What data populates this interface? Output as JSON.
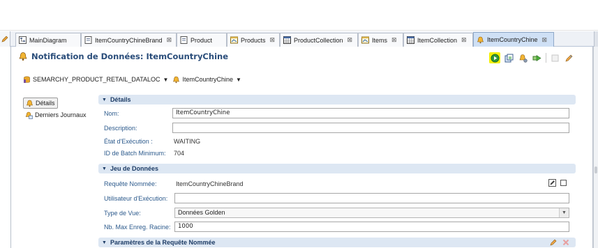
{
  "tabs": [
    {
      "label": "MainDiagram",
      "icon": "diagram-icon",
      "closable": false,
      "active": false
    },
    {
      "label": "ItemCountryChineBrand",
      "icon": "entity-icon",
      "closable": true,
      "active": false
    },
    {
      "label": "Product",
      "icon": "entity-icon",
      "closable": false,
      "active": false
    },
    {
      "label": "Products",
      "icon": "collection-icon",
      "closable": true,
      "active": false
    },
    {
      "label": "ProductCollection",
      "icon": "table-icon",
      "closable": true,
      "active": false
    },
    {
      "label": "Items",
      "icon": "collection-icon",
      "closable": true,
      "active": false
    },
    {
      "label": "ItemCollection",
      "icon": "table-icon",
      "closable": true,
      "active": false
    },
    {
      "label": "ItemCountryChine",
      "icon": "bell-icon",
      "closable": true,
      "active": true
    }
  ],
  "editor": {
    "title": "Notification de Données: ItemCountryChine",
    "breadcrumb": {
      "dataloc": "SEMARCHY_PRODUCT_RETAIL_DATALOC",
      "item": "ItemCountryChine"
    }
  },
  "toolbar": {
    "buttons": [
      "run-icon",
      "export-icon",
      "bell-gear-icon",
      "forward-icon",
      "disabled-icon",
      "edit-icon"
    ],
    "highlight": "#f3f000"
  },
  "nav": {
    "items": [
      {
        "label": "Détails",
        "selected": true
      },
      {
        "label": "Derniers Journaux",
        "selected": false
      }
    ]
  },
  "details": {
    "title": "Détails",
    "name_label": "Nom:",
    "name_value": "ItemCountryChine",
    "description_label": "Description:",
    "description_value": "",
    "state_label": "État d'Exécution :",
    "state_value": "WAITING",
    "batch_label": "ID de Batch Minimum:",
    "batch_value": "704"
  },
  "dataset": {
    "title": "Jeu de Données",
    "query_label": "Requête Nommée:",
    "query_value": "ItemCountryChineBrand",
    "user_label": "Utilisateur d'Exécution:",
    "user_value": "",
    "view_label": "Type de Vue:",
    "view_value": "Données Golden",
    "max_label": "Nb. Max Enreg. Racine:",
    "max_value": "1000"
  },
  "params": {
    "title": "Paramètres de la Requête Nommée"
  },
  "colors": {
    "section_bg": "#dde7f3",
    "label": "#2c5a8c",
    "title": "#2a4d7a",
    "active_tab": "#cfe0f5"
  }
}
